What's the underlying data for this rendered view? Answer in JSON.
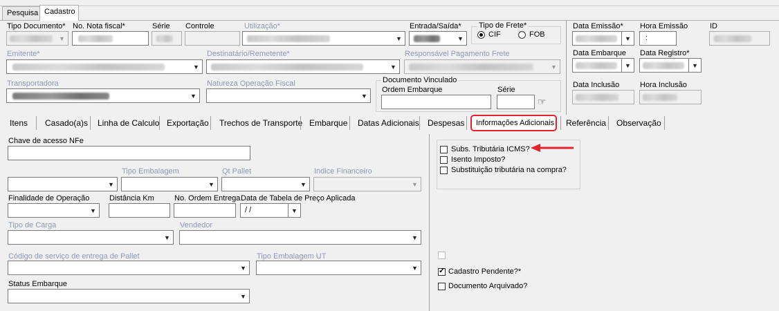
{
  "top_tabs": [
    {
      "label": "Pesquisa",
      "active": false
    },
    {
      "label": "Cadastro",
      "active": true
    }
  ],
  "header": {
    "tipo_documento": {
      "label": "Tipo Documento*"
    },
    "no_nota_fiscal": {
      "label": "No. Nota fiscal*"
    },
    "serie": {
      "label": "Série"
    },
    "controle": {
      "label": "Controle"
    },
    "utilizacao": {
      "label": "Utilização*"
    },
    "entrada_saida": {
      "label": "Entrada/Saída*"
    },
    "tipo_frete": {
      "label": "Tipo de Frete*",
      "options": [
        {
          "label": "CIF",
          "selected": true
        },
        {
          "label": "FOB",
          "selected": false
        }
      ]
    },
    "emitente": {
      "label": "Emitente*"
    },
    "destinatario": {
      "label": "Destinatário/Remetente*"
    },
    "responsavel_frete": {
      "label": "Responsável Pagamento Frete"
    },
    "transportadora": {
      "label": "Transportadora"
    },
    "natureza_operacao": {
      "label": "Natureza Operação Fiscal"
    },
    "documento_vinculado": {
      "label": "Documento Vinculado",
      "ordem_embarque": {
        "label": "Ordem Embarque"
      },
      "serie": {
        "label": "Série"
      }
    }
  },
  "right_panel": {
    "data_emissao": {
      "label": "Data Emissão*"
    },
    "hora_emissao": {
      "label": "Hora Emissão",
      "value": ":"
    },
    "id": {
      "label": "ID"
    },
    "data_embarque": {
      "label": "Data Embarque"
    },
    "data_registro": {
      "label": "Data Registro*"
    },
    "data_inclusao": {
      "label": "Data Inclusão"
    },
    "hora_inclusao": {
      "label": "Hora Inclusão"
    }
  },
  "section_tabs": [
    {
      "label": "Itens",
      "active": false
    },
    {
      "label": "Casado(a)s",
      "active": false
    },
    {
      "label": "Linha de Calculo",
      "active": false
    },
    {
      "label": "Exportação",
      "active": false
    },
    {
      "label": "Trechos de Transporte",
      "active": false
    },
    {
      "label": "Embarque",
      "active": false
    },
    {
      "label": "Datas Adicionais",
      "active": false
    },
    {
      "label": "Despesas",
      "active": false
    },
    {
      "label": "Informações Adicionais",
      "active": true
    },
    {
      "label": "Referência",
      "active": false
    },
    {
      "label": "Observação",
      "active": false
    }
  ],
  "info_adicionais": {
    "chave_acesso": {
      "label": "Chave de acesso NFe",
      "value": ""
    },
    "tipo_embalagem": {
      "label": "Tipo Embalagem"
    },
    "qt_pallet": {
      "label": "Qt Pallet"
    },
    "indice_financeiro": {
      "label": "Indice Financeiro"
    },
    "finalidade_operacao": {
      "label": "Finalidade de Operação"
    },
    "distancia_km": {
      "label": "Distância Km"
    },
    "no_ordem_entrega": {
      "label": "No. Ordem Entrega"
    },
    "data_tabela_preco": {
      "label": "Data de Tabela de Preço Aplicada",
      "value": " /  /"
    },
    "tipo_carga": {
      "label": "Tipo de Carga"
    },
    "vendedor": {
      "label": "Vendedor"
    },
    "codigo_servico_pallet": {
      "label": "Código de serviço de entrega de Pallet"
    },
    "tipo_embalagem_ut": {
      "label": "Tipo Embalagem UT"
    },
    "status_embarque": {
      "label": "Status Embarque"
    }
  },
  "tax_checkboxes": [
    {
      "label": "Subs. Tributária ICMS?",
      "checked": false
    },
    {
      "label": "Isento Imposto?",
      "checked": false
    },
    {
      "label": "Substituição tributária na compra?",
      "checked": false
    }
  ],
  "bottom_checkboxes": [
    {
      "label": "",
      "checked": false,
      "disabled": true
    },
    {
      "label": "Cadastro Pendente?*",
      "checked": true,
      "disabled": false
    },
    {
      "label": "Documento Arquivado?",
      "checked": false,
      "disabled": false
    }
  ],
  "colors": {
    "highlight": "#e5232a",
    "disabled_label": "#8e99b8"
  }
}
